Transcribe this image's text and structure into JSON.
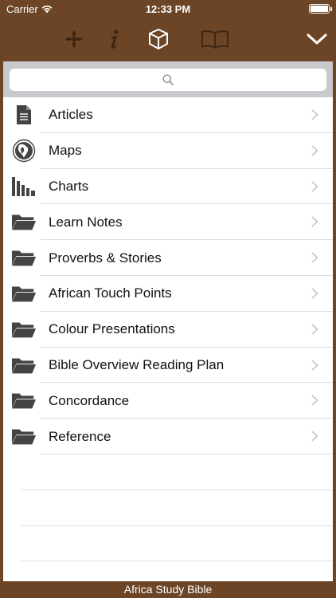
{
  "status_bar": {
    "carrier": "Carrier",
    "time": "12:33 PM",
    "battery_level": 1.0
  },
  "toolbar": {
    "icons": [
      "cross-icon",
      "info-icon",
      "cube-icon",
      "book-icon",
      "chevron-down-icon"
    ],
    "icon_color": "#3e2611",
    "active_icon_color": "#ffffff"
  },
  "search": {
    "placeholder": ""
  },
  "menu": {
    "items": [
      {
        "label": "Articles",
        "icon": "document-icon"
      },
      {
        "label": "Maps",
        "icon": "globe-icon"
      },
      {
        "label": "Charts",
        "icon": "bar-chart-icon"
      },
      {
        "label": "Learn Notes",
        "icon": "folder-icon"
      },
      {
        "label": "Proverbs & Stories",
        "icon": "folder-icon"
      },
      {
        "label": "African Touch Points",
        "icon": "folder-icon"
      },
      {
        "label": "Colour Presentations",
        "icon": "folder-icon"
      },
      {
        "label": "Bible Overview Reading Plan",
        "icon": "folder-icon"
      },
      {
        "label": "Concordance",
        "icon": "folder-icon"
      },
      {
        "label": "Reference",
        "icon": "folder-icon"
      }
    ]
  },
  "footer": {
    "title": "Africa Study Bible"
  },
  "colors": {
    "background": "#6b4526",
    "panel": "#ffffff",
    "search_bar": "#c9c9ce",
    "icon": "#444444",
    "chevron": "#c7c7cc"
  }
}
